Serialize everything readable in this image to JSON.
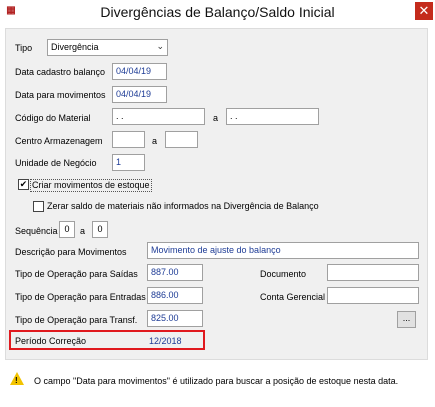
{
  "window": {
    "title": "Divergências de Balanço/Saldo Inicial",
    "app_icon": "app-logo-icon",
    "close_glyph": "✕"
  },
  "form": {
    "tipo_label": "Tipo",
    "tipo_value": "Divergência",
    "data_cadastro_label": "Data cadastro balanço",
    "data_cadastro_value": "04/04/19",
    "data_movimentos_label": "Data para movimentos",
    "data_movimentos_value": "04/04/19",
    "codigo_material_label": "Código do Material",
    "codigo_material_from": " .  .",
    "codigo_material_to": " .  .",
    "a_label": "a",
    "centro_label": "Centro Armazenagem",
    "centro_from": "",
    "centro_to": "",
    "unidade_label": "Unidade de Negócio",
    "unidade_value": "1",
    "criar_mov_label": "Criar movimentos de estoque",
    "criar_mov_checked": "✔",
    "zerar_label": "Zerar saldo de materiais não informados na Divergência de Balanço",
    "sequencia_label": "Sequência",
    "sequencia_from": "0",
    "sequencia_to": "0",
    "descricao_label": "Descrição para Movimentos",
    "descricao_value": "Movimento de ajuste do balanço",
    "tipo_saidas_label": "Tipo de Operação para Saídas",
    "tipo_saidas_value": "887.00",
    "tipo_entradas_label": "Tipo de Operação para Entradas",
    "tipo_entradas_value": "886.00",
    "tipo_transf_label": "Tipo de Operação para Transf.",
    "tipo_transf_value": "825.00",
    "documento_label": "Documento",
    "documento_value": "",
    "conta_label": "Conta Gerencial",
    "conta_value": "",
    "ellipsis": "...",
    "periodo_label": "Período Correção",
    "periodo_value": "12/2018"
  },
  "footer": {
    "warning_icon": "warning-icon",
    "message": "O campo \"Data para movimentos\" é utilizado para buscar a posição de estoque nesta data."
  },
  "colors": {
    "highlight_border": "#e0191e",
    "value_text": "#1e3c96",
    "close_button": "#c42b1c"
  }
}
